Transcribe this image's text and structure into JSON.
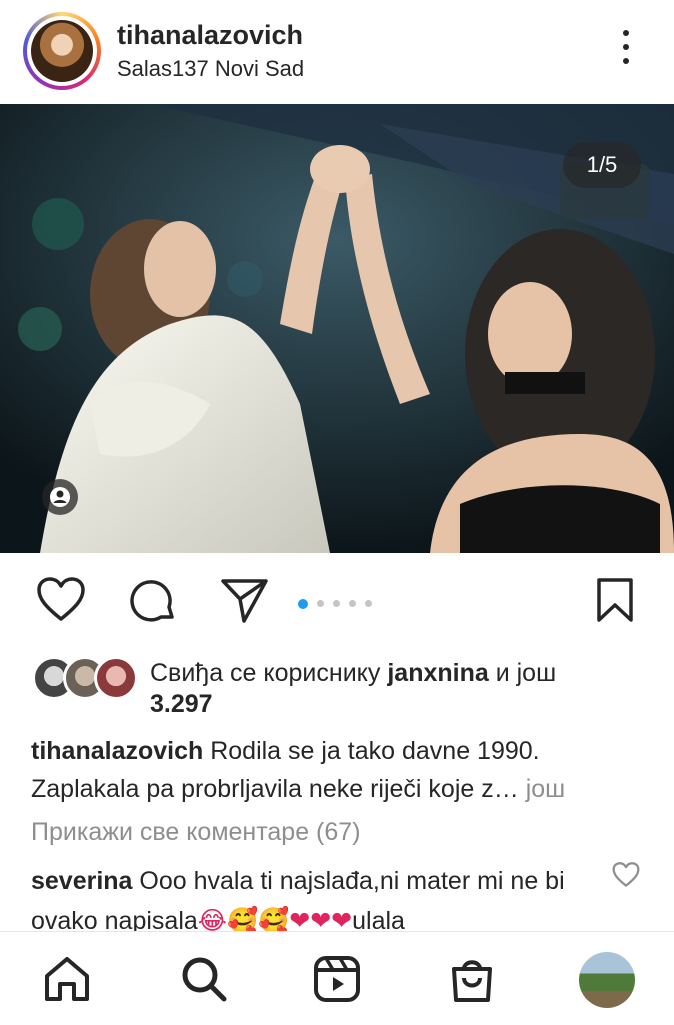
{
  "header": {
    "username": "tihanalazovich",
    "location": "Salas137 Novi Sad"
  },
  "post": {
    "counter": "1/5",
    "carousel": {
      "current": 1,
      "total": 5
    }
  },
  "likes": {
    "prefix": "Свиђа се кориснику ",
    "user": "janxnina",
    "suffix": " и још",
    "count": "3.297"
  },
  "caption": {
    "username": "tihanalazovich",
    "text": " Rodila se ja tako davne 1990. Zaplakala pa probrljavila neke riječi koje z…",
    "more": "још"
  },
  "comments": {
    "view_all": "Прикажи све коментаре (67)",
    "first": {
      "username": "severina",
      "text": " Ooo hvala ti najslađa,ni mater mi ne bi ovako napisala",
      "emojis": "😂🥰🥰❤❤❤",
      "tail": "ulala"
    }
  },
  "colors": {
    "accent": "#1d9bf0",
    "text": "#262626",
    "muted": "#8e8e8e"
  },
  "icons": [
    "more-vertical-icon",
    "person-tag-icon",
    "heart-icon",
    "comment-icon",
    "share-icon",
    "bookmark-icon",
    "home-icon",
    "search-icon",
    "reels-icon",
    "shop-icon"
  ]
}
